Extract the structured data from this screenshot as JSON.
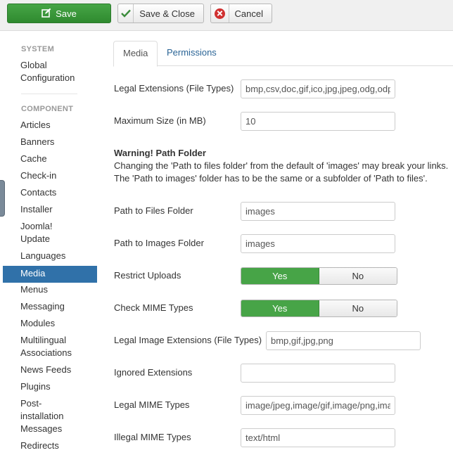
{
  "toolbar": {
    "save_label": "Save",
    "save_close_label": "Save & Close",
    "cancel_label": "Cancel"
  },
  "sidebar": {
    "system_header": "SYSTEM",
    "system_items": [
      {
        "label": "Global"
      },
      {
        "label": "Configuration"
      }
    ],
    "component_header": "COMPONENT",
    "items": [
      {
        "label": "Articles"
      },
      {
        "label": "Banners"
      },
      {
        "label": "Cache"
      },
      {
        "label": "Check-in"
      },
      {
        "label": "Contacts"
      },
      {
        "label": "Installer"
      },
      {
        "label": "Joomla!"
      },
      {
        "label": "Update"
      },
      {
        "label": "Languages"
      },
      {
        "label": "Media",
        "active": true
      },
      {
        "label": "Menus"
      },
      {
        "label": "Messaging"
      },
      {
        "label": "Modules"
      },
      {
        "label": "Multilingual"
      },
      {
        "label": "Associations"
      },
      {
        "label": "News Feeds"
      },
      {
        "label": "Plugins"
      },
      {
        "label": "Post-"
      },
      {
        "label": "installation"
      },
      {
        "label": "Messages"
      },
      {
        "label": "Redirects"
      }
    ]
  },
  "tabs": [
    {
      "label": "Media",
      "active": true
    },
    {
      "label": "Permissions",
      "active": false
    }
  ],
  "form": {
    "legal_extensions": {
      "label": "Legal Extensions (File Types)",
      "value": "bmp,csv,doc,gif,ico,jpg,jpeg,odg,odp"
    },
    "maximum_size": {
      "label": "Maximum Size (in MB)",
      "value": "10"
    },
    "warning": {
      "title": "Warning! Path Folder",
      "line1": "Changing the 'Path to files folder' from the default of 'images' may break your links.",
      "line2": "The 'Path to images' folder has to be the same or a subfolder of 'Path to files'."
    },
    "path_files": {
      "label": "Path to Files Folder",
      "value": "images"
    },
    "path_images": {
      "label": "Path to Images Folder",
      "value": "images"
    },
    "restrict_uploads": {
      "label": "Restrict Uploads",
      "yes": "Yes",
      "no": "No",
      "selected": "Yes"
    },
    "check_mime": {
      "label": "Check MIME Types",
      "yes": "Yes",
      "no": "No",
      "selected": "Yes"
    },
    "legal_image_ext": {
      "label": "Legal Image Extensions (File Types)",
      "value": "bmp,gif,jpg,png"
    },
    "ignored_ext": {
      "label": "Ignored Extensions",
      "value": ""
    },
    "legal_mime": {
      "label": "Legal MIME Types",
      "value": "image/jpeg,image/gif,image/png,image/bmp"
    },
    "illegal_mime": {
      "label": "Illegal MIME Types",
      "value": "text/html"
    }
  },
  "colors": {
    "save_green": "#46a546",
    "active_blue": "#3071a9",
    "toggle_yes_green": "#47a447",
    "cancel_red": "#d03030"
  }
}
